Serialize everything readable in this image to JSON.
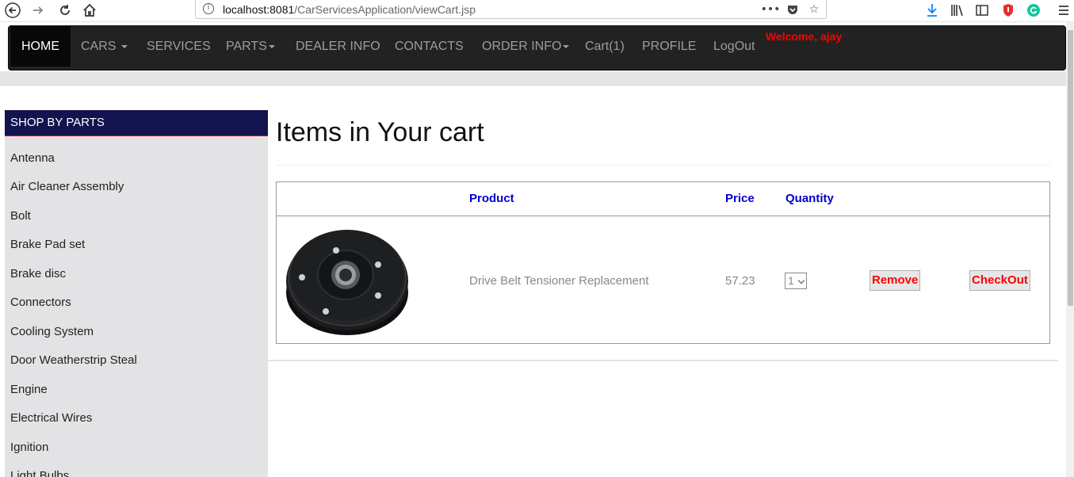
{
  "browser": {
    "url_host": "localhost:8081",
    "url_path": "/CarServicesApplication/viewCart.jsp"
  },
  "navbar": {
    "items": [
      {
        "label": "HOME",
        "active": true
      },
      {
        "label": "CARS",
        "caret": true
      },
      {
        "label": "SERVICES"
      },
      {
        "label": "PARTS",
        "caret": true
      },
      {
        "label": "DEALER INFO"
      },
      {
        "label": "CONTACTS"
      },
      {
        "label": "ORDER INFO",
        "caret": true
      },
      {
        "label": "Cart(1)"
      },
      {
        "label": "PROFILE"
      },
      {
        "label": "LogOut"
      }
    ],
    "welcome": "Welcome, ajay"
  },
  "sidebar": {
    "title": "SHOP BY PARTS",
    "items": [
      "Antenna",
      "Air Cleaner Assembly",
      "Bolt",
      "Brake Pad set",
      "Brake disc",
      "Connectors",
      "Cooling System",
      "Door Weatherstrip Steal",
      "Engine",
      "Electrical Wires",
      "Ignition",
      "Light Bulbs"
    ]
  },
  "main": {
    "title": "Items in Your cart",
    "table": {
      "headers": {
        "product": "Product",
        "price": "Price",
        "quantity": "Quantity"
      },
      "rows": [
        {
          "product": "Drive Belt Tensioner Replacement",
          "price": "57.23",
          "quantity": "1",
          "remove_label": "Remove",
          "checkout_label": "CheckOut"
        }
      ]
    }
  },
  "colors": {
    "navbar_bg": "#222222",
    "sidebar_head_bg": "#13134f",
    "header_text": "#0000cc",
    "accent_red": "#ff0000"
  }
}
